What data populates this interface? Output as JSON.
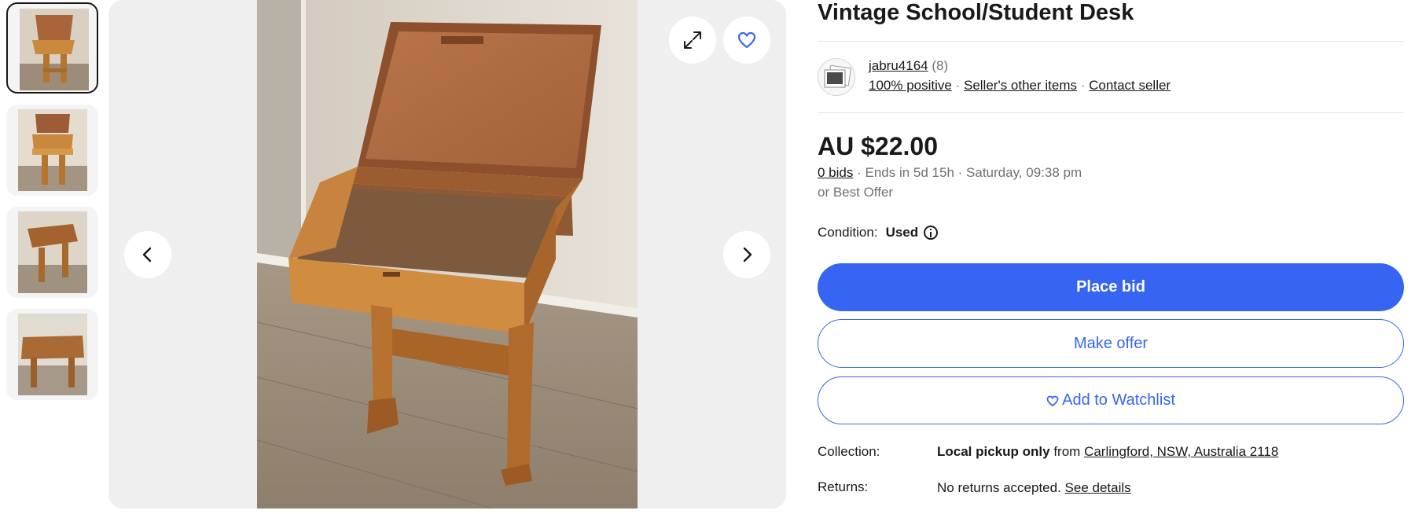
{
  "thumbnails": [
    {
      "label": "Photo 1",
      "active": true
    },
    {
      "label": "Photo 2",
      "active": false
    },
    {
      "label": "Photo 3",
      "active": false
    },
    {
      "label": "Photo 4",
      "active": false
    }
  ],
  "gallery": {
    "icons": {
      "expand": "expand-icon",
      "watch": "heart-icon",
      "prev": "chevron-left-icon",
      "next": "chevron-right-icon"
    }
  },
  "listing": {
    "title": "Vintage School/Student Desk"
  },
  "seller": {
    "name": "jabru4164",
    "feedback_count": "(8)",
    "positive": "100% positive",
    "separator": "·",
    "other_items": "Seller's other items",
    "contact": "Contact seller"
  },
  "pricing": {
    "price": "AU $22.00",
    "bids": "0 bids",
    "ends": "· Ends in 5d 15h · Saturday, 09:38 pm",
    "best_offer": "or Best Offer"
  },
  "condition": {
    "label": "Condition:",
    "value": "Used"
  },
  "actions": {
    "place_bid": "Place bid",
    "make_offer": "Make offer",
    "watchlist": "Add to Watchlist"
  },
  "collection": {
    "label": "Collection:",
    "method": "Local pickup only",
    "from": "from",
    "location": "Carlingford, NSW, Australia 2118"
  },
  "returns": {
    "label": "Returns:",
    "policy": "No returns accepted.",
    "details_link": "See details"
  },
  "colors": {
    "primary": "#3665f3",
    "text": "#191919",
    "muted": "#707070",
    "gallery_bg": "#efefef"
  }
}
